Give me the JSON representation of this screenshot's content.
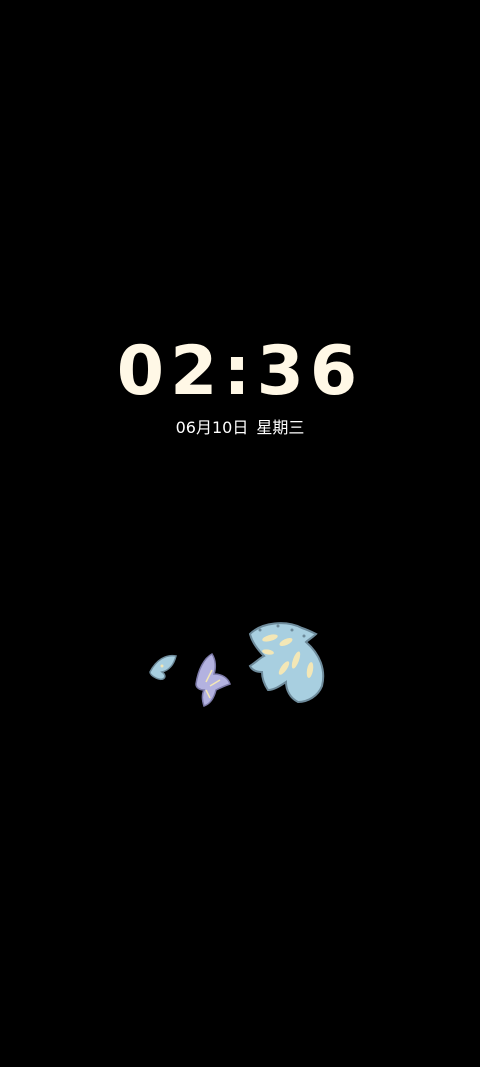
{
  "lock_screen": {
    "time": "02:36",
    "date": "06月10日",
    "weekday": "星期三"
  },
  "artwork": {
    "icon": "flying-birds-icon",
    "colors": {
      "background": "#000000",
      "clock_text": "#FFF8E6",
      "bird_blue": "#A8CFE0",
      "bird_lilac": "#B3B2E0",
      "bird_outline": "#6E8B9B",
      "bird_accent": "#F3E7B6"
    }
  }
}
